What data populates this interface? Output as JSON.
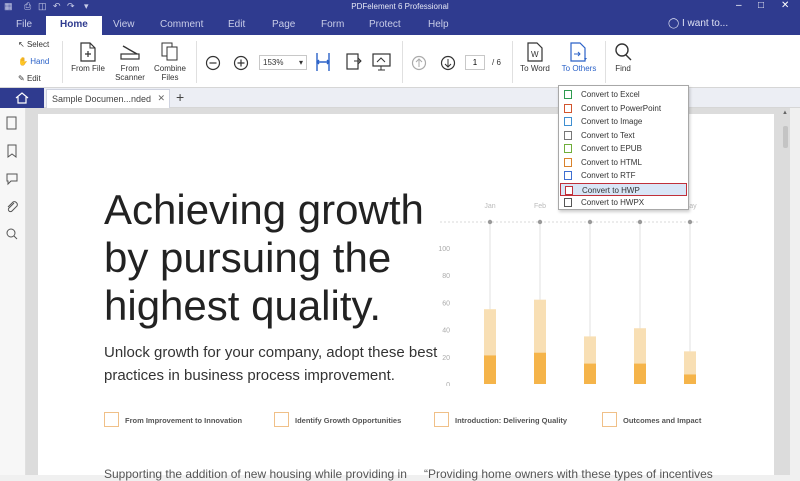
{
  "app": {
    "title": "PDFelement 6 Professional"
  },
  "menu": {
    "tabs": [
      "File",
      "Home",
      "View",
      "Comment",
      "Edit",
      "Page",
      "Form",
      "Protect",
      "Help"
    ],
    "active": "Home",
    "search_placeholder": "I want to..."
  },
  "ribbon": {
    "select": "Select",
    "hand": "Hand",
    "edit": "Edit",
    "from_file": "From File",
    "from_scanner": [
      "From",
      "Scanner"
    ],
    "combine": [
      "Combine",
      "Files"
    ],
    "zoom": "153%",
    "page_current": "1",
    "page_total": "/ 6",
    "to_word": "To Word",
    "to_others": "To Others",
    "find": "Find"
  },
  "tabs": {
    "doc": "Sample Documen...nded",
    "add": "+"
  },
  "document": {
    "heading": [
      "Achieving growth",
      "by pursuing the",
      "highest quality."
    ],
    "subtext": "Unlock growth for your company, adopt these best practices in business process improvement.",
    "features": [
      "From Improvement to Innovation",
      "Identify Growth Opportunities",
      "Introduction: Delivering Quality",
      "Outcomes and Impact"
    ],
    "bottom_left": "Supporting the addition of new housing while providing in",
    "bottom_right": "“Providing home owners with these types of incentives"
  },
  "chart_data": {
    "type": "bar",
    "categories": [
      "Jan",
      "Feb",
      "",
      "",
      "May"
    ],
    "series": [
      {
        "values": [
          55,
          62,
          35,
          41,
          24
        ]
      },
      {
        "values": [
          21,
          23,
          15,
          15,
          7
        ]
      }
    ],
    "yticks": [
      0,
      20,
      40,
      60,
      80,
      100
    ],
    "ylim": [
      0,
      100
    ],
    "colors": [
      "#f8dfb4",
      "#f5b44a"
    ]
  },
  "dropdown": {
    "items": [
      "Convert to Excel",
      "Convert to PowerPoint",
      "Convert to Image",
      "Convert to Text",
      "Convert to EPUB",
      "Convert to HTML",
      "Convert to RTF",
      "Convert to HWP",
      "Convert to HWPX"
    ],
    "selected": 7,
    "icon_colors": [
      "#2e9b4f",
      "#d2552e",
      "#3f8fd1",
      "#777777",
      "#6fae3a",
      "#d9822b",
      "#3f6fd1",
      "#c0303a",
      "#555555"
    ]
  },
  "colors": {
    "accent": "#2f3b8f",
    "icon_blue": "#2b62c8",
    "highlight_border": "#c0303a"
  }
}
